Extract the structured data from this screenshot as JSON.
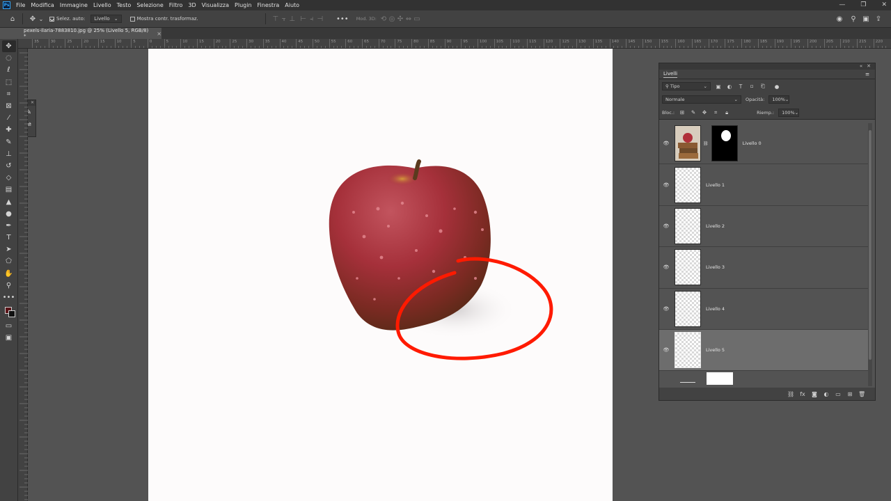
{
  "menubar": {
    "logo": "Ps",
    "items": [
      "File",
      "Modifica",
      "Immagine",
      "Livello",
      "Testo",
      "Selezione",
      "Filtro",
      "3D",
      "Visualizza",
      "Plugin",
      "Finestra",
      "Aiuto"
    ],
    "window_controls": [
      "—",
      "❐",
      "✕"
    ]
  },
  "options": {
    "auto_select_label": "Selez. auto:",
    "auto_select_value": "Livello",
    "show_transform_label": "Mostra contr. trasformaz.",
    "mode_3d_label": "Mod. 3D:"
  },
  "document": {
    "tab_title": "pexels-ilaria-7883810.jpg @ 25% (Livello 5, RGB/8) *",
    "close": "×"
  },
  "rulers": {
    "h_ticks": [
      "35",
      "30",
      "25",
      "20",
      "15",
      "10",
      "5",
      "0",
      "5",
      "10",
      "15",
      "20",
      "25",
      "30",
      "35",
      "40",
      "45",
      "50",
      "55",
      "60",
      "65",
      "70",
      "75",
      "80",
      "85",
      "90",
      "95",
      "100",
      "105",
      "110",
      "115",
      "120",
      "125",
      "130",
      "135",
      "140",
      "145",
      "150",
      "155",
      "160",
      "165",
      "170",
      "175",
      "180",
      "185",
      "190",
      "195",
      "200",
      "205",
      "210",
      "215",
      "220",
      "225"
    ]
  },
  "colors": {
    "foreground": "#5a1418",
    "background": "#111111",
    "annotation_stroke": "#ff1a00",
    "accent": "#31a8ff"
  },
  "layers_panel": {
    "title": "Livelli",
    "filter_value": "Tipo",
    "blend_mode": "Normale",
    "opacity_label": "Opacità:",
    "opacity_value": "100%",
    "lock_label": "Bloc.:",
    "fill_label": "Riemp.:",
    "fill_value": "100%",
    "layers": [
      {
        "name": "Livello 0",
        "visible": true,
        "selected": false,
        "has_mask": true
      },
      {
        "name": "Livello 1",
        "visible": true,
        "selected": false,
        "has_mask": false
      },
      {
        "name": "Livello 2",
        "visible": true,
        "selected": false,
        "has_mask": false
      },
      {
        "name": "Livello 3",
        "visible": true,
        "selected": false,
        "has_mask": false
      },
      {
        "name": "Livello 4",
        "visible": true,
        "selected": false,
        "has_mask": false
      },
      {
        "name": "Livello 5",
        "visible": true,
        "selected": true,
        "has_mask": false
      }
    ]
  }
}
